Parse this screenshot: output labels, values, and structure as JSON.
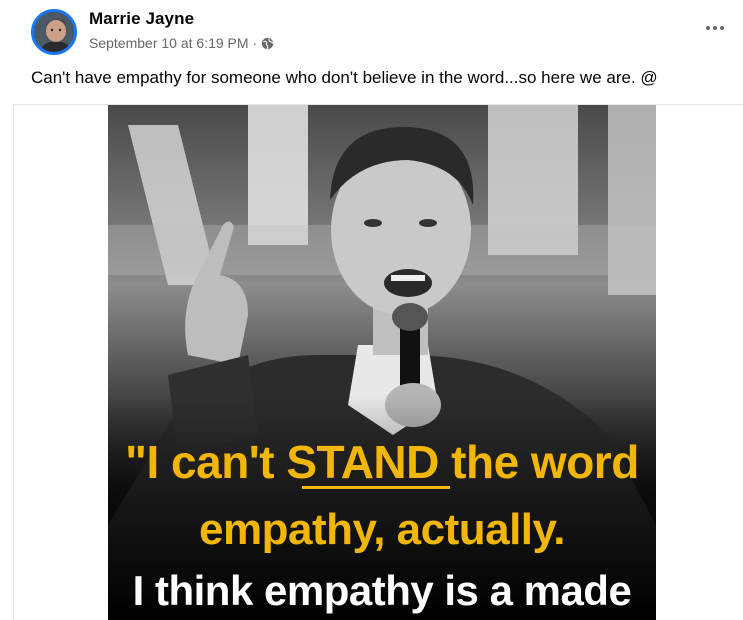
{
  "post": {
    "author": "Marrie Jayne",
    "date": "September 10 at 6:19 PM",
    "separator": "·",
    "privacy_icon": "globe-icon",
    "more_icon": "more-options-icon",
    "caption": "Can't have empathy for someone who don't believe in the word...so here we are. @"
  },
  "image": {
    "quote_line_1": "\"I can't STAND the word",
    "quote_line_2": "empathy, actually.",
    "quote_line_3": "I think empathy is a made",
    "quote_color": "#f2b705",
    "quote_color_secondary": "#ffffff"
  }
}
